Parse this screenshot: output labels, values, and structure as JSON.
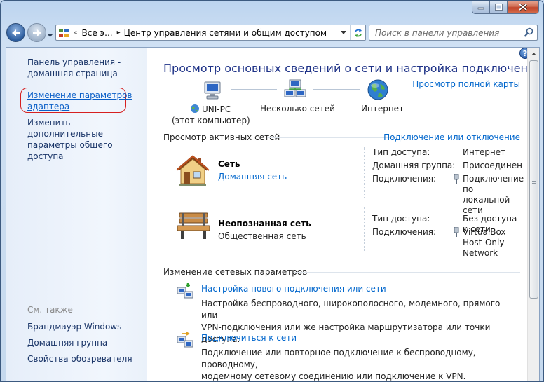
{
  "window": {
    "caption_buttons": [
      "minimize",
      "maximize",
      "close"
    ]
  },
  "address_bar": {
    "segments": [
      "Все э...",
      "Центр управления сетями и общим доступом"
    ]
  },
  "search": {
    "placeholder": "Поиск в панели управления"
  },
  "sidebar": {
    "home_line1": "Панель управления -",
    "home_line2": "домашняя страница",
    "adapter_line1": "Изменение параметров",
    "adapter_line2": "адаптера",
    "sharing_line1": "Изменить дополнительные",
    "sharing_line2": "параметры общего доступа",
    "see_also": "См. также",
    "see_also_links": [
      "Брандмауэр Windows",
      "Домашняя группа",
      "Свойства обозревателя"
    ]
  },
  "main": {
    "title": "Просмотр основных сведений о сети и настройка подключений",
    "full_map_link": "Просмотр полной карты",
    "map": {
      "computer_name": "UNI-PC",
      "computer_sub": "(этот компьютер)",
      "networks": "Несколько сетей",
      "internet": "Интернет"
    },
    "active_networks": {
      "heading": "Просмотр активных сетей",
      "connect_link": "Подключение или отключение",
      "networks": [
        {
          "name": "Сеть",
          "type": "Домашняя сеть",
          "access_label": "Тип доступа:",
          "access_value": "Интернет",
          "homegroup_label": "Домашняя группа:",
          "homegroup_value": "Присоединен",
          "conn_label": "Подключения:",
          "conn_line1": "Подключение по",
          "conn_line2": "локальной сети"
        },
        {
          "name": "Неопознанная сеть",
          "type": "Общественная сеть",
          "access_label": "Тип доступа:",
          "access_value": "Без доступа к сети",
          "conn_label": "Подключения:",
          "conn_line1": "VirtualBox",
          "conn_line2": "Host-Only Network"
        }
      ]
    },
    "change_settings": {
      "heading": "Изменение сетевых параметров",
      "tasks": [
        {
          "title": "Настройка нового подключения или сети",
          "desc_line1": "Настройка беспроводного, широкополосного, модемного, прямого или",
          "desc_line2": "VPN-подключения или же настройка маршрутизатора или точки доступа."
        },
        {
          "title": "Подключиться к сети",
          "desc_line1": "Подключение или повторное подключение к беспроводному, проводному,",
          "desc_line2": "модемному сетевому соединению или подключение к VPN."
        }
      ]
    }
  },
  "colors": {
    "title_blue": "#1e3287",
    "link_blue": "#0066cc",
    "highlight_red": "#d62020"
  }
}
